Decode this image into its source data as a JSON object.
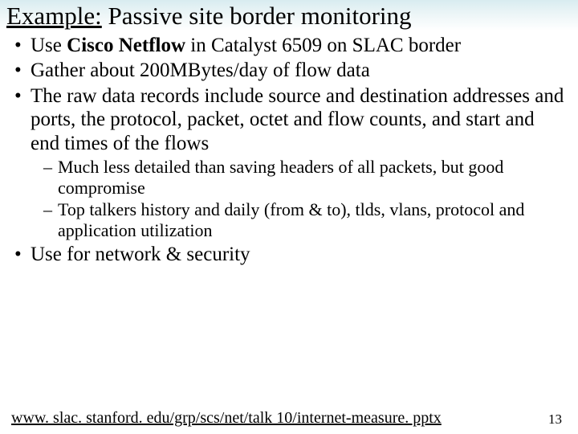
{
  "title": {
    "underlined": "Example:",
    "rest": " Passive site border monitoring"
  },
  "bullets": {
    "b1_pre": "Use ",
    "b1_bold": "Cisco Netflow",
    "b1_post": " in Catalyst 6509 on SLAC border",
    "b2": "Gather about 200MBytes/day of flow data",
    "b3": "The raw data records include source and destination addresses and ports, the protocol, packet, octet and flow counts, and start and end times of the flows",
    "b3_sub1": "Much less detailed than saving headers of all packets, but good compromise",
    "b3_sub2": "Top talkers history and daily (from & to), tlds, vlans, protocol and application utilization",
    "b4": "Use for network & security"
  },
  "footer": {
    "link": "www. slac. stanford. edu/grp/scs/net/talk 10/internet-measure. pptx",
    "page": "13"
  }
}
